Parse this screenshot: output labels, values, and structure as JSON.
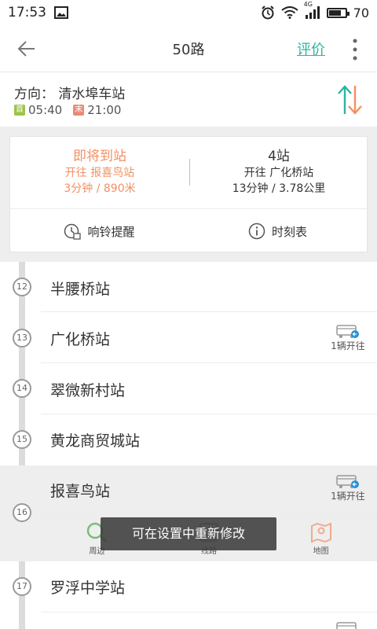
{
  "status_bar": {
    "time": "17:53",
    "battery": "70",
    "network": "4G",
    "battery_level": 0.7
  },
  "header": {
    "title": "50路",
    "rate_label": "评价"
  },
  "direction": {
    "label": "方向：",
    "destination": "清水埠车站",
    "first_tag": "首",
    "first_time": "05:40",
    "last_tag": "末",
    "last_time": "21:00"
  },
  "arrival": {
    "left": {
      "main": "即将到站",
      "sub1": "开往 报喜鸟站",
      "sub2": "3分钟 / 890米"
    },
    "right": {
      "main": "4站",
      "sub1": "开往 广化桥站",
      "sub2": "13分钟 / 3.78公里"
    }
  },
  "actions": {
    "alarm_label": "响铃提醒",
    "schedule_label": "时刻表"
  },
  "stops": [
    {
      "num": "12",
      "name": "半腰桥站",
      "bus": ""
    },
    {
      "num": "13",
      "name": "广化桥站",
      "bus": "1辆开往"
    },
    {
      "num": "14",
      "name": "翠微新村站",
      "bus": ""
    },
    {
      "num": "15",
      "name": "黄龙商贸城站",
      "bus": ""
    },
    {
      "num": "16",
      "name": "报喜鸟站",
      "bus": "1辆开往"
    },
    {
      "num": "17",
      "name": "罗浮中学站",
      "bus": ""
    }
  ],
  "bottom_nav": {
    "nearby": "周边",
    "route": "线路",
    "map": "地图"
  },
  "toast": "可在设置中重新修改",
  "colors": {
    "accent": "#2bb5a0",
    "orange": "#f29063",
    "first_tag": "#9bc34a",
    "last_tag": "#e98b73"
  }
}
